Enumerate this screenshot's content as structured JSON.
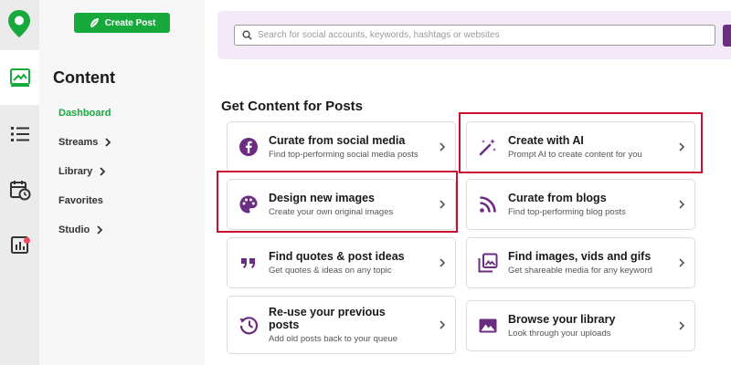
{
  "sidebar": {
    "create_post_label": "Create Post",
    "section_title": "Content",
    "items": [
      {
        "label": "Dashboard"
      },
      {
        "label": "Streams"
      },
      {
        "label": "Library"
      },
      {
        "label": "Favorites"
      },
      {
        "label": "Studio"
      }
    ]
  },
  "search": {
    "placeholder": "Search for social accounts, keywords, hashtags or websites"
  },
  "main": {
    "section_title": "Get Content for Posts",
    "cards": [
      {
        "title": "Curate from social media",
        "desc": "Find top-performing social media posts",
        "icon": "facebook-icon"
      },
      {
        "title": "Create with AI",
        "desc": "Prompt AI to create content for you",
        "icon": "magic-wand-icon"
      },
      {
        "title": "Design new images",
        "desc": "Create your own original images",
        "icon": "palette-icon"
      },
      {
        "title": "Curate from blogs",
        "desc": "Find top-performing blog posts",
        "icon": "rss-icon"
      },
      {
        "title": "Find quotes & post ideas",
        "desc": "Get quotes & ideas on any topic",
        "icon": "quote-icon"
      },
      {
        "title": "Find images, vids and gifs",
        "desc": "Get shareable media for any keyword",
        "icon": "media-gallery-icon"
      },
      {
        "title": "Re-use your previous posts",
        "desc": "Add old posts back to your queue",
        "icon": "history-icon"
      },
      {
        "title": "Browse your library",
        "desc": "Look through your uploads",
        "icon": "image-icon"
      }
    ]
  },
  "colors": {
    "brand_green": "#18a93d",
    "accent_purple": "#6b2d82",
    "highlight_red": "#c8102e",
    "notification": "#ef4b5c"
  }
}
